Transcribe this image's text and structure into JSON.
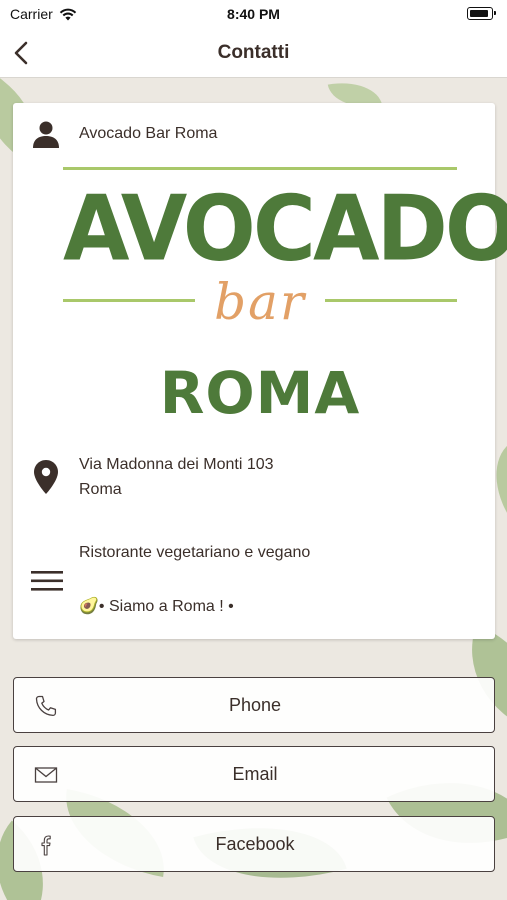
{
  "status_bar": {
    "carrier": "Carrier",
    "time": "8:40 PM"
  },
  "nav": {
    "title": "Contatti",
    "back_icon": "chevron-left-icon"
  },
  "card": {
    "name": "Avocado Bar Roma",
    "logo": {
      "line1": "AVOCADO",
      "line2": "bar",
      "line3": "ROMA"
    },
    "address_line1": "Via Madonna dei Monti 103",
    "address_line2": "Roma",
    "description_line1": "Ristorante vegetariano e vegano",
    "description_line2": "🥑• Siamo a Roma ! •"
  },
  "buttons": [
    {
      "label": "Phone",
      "icon": "phone-icon"
    },
    {
      "label": "Email",
      "icon": "mail-icon"
    },
    {
      "label": "Facebook",
      "icon": "facebook-icon"
    }
  ],
  "colors": {
    "brand_green": "#4e7a3a",
    "brand_orange": "#e2a066",
    "text_brown": "#3b2f2a"
  }
}
